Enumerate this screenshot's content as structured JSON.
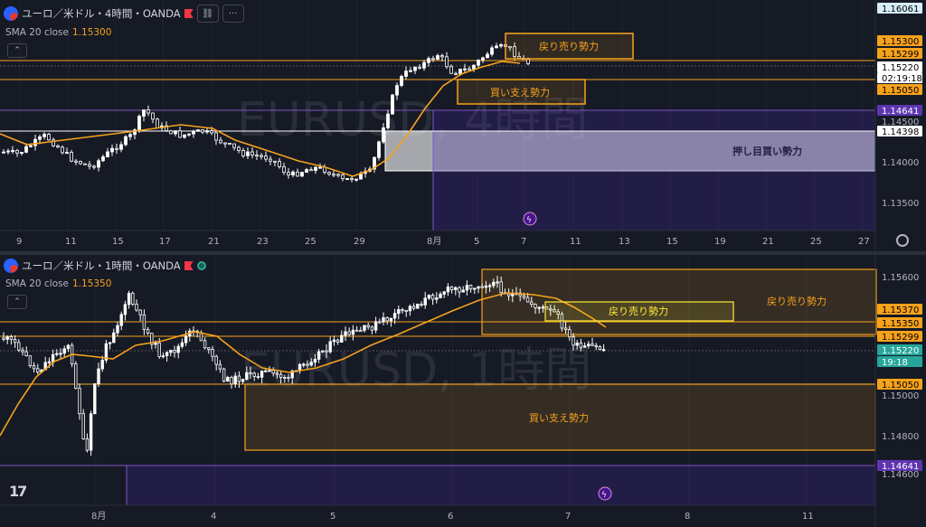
{
  "top": {
    "title": "ユーロ／米ドル・4時間・OANDA",
    "sma_label": "SMA 20 close",
    "sma_value": "1.15300",
    "watermark": "EURUSD, 4時間",
    "x_labels": [
      "9",
      "11",
      "15",
      "17",
      "21",
      "23",
      "25",
      "29",
      "8月",
      "5",
      "7",
      "11",
      "13",
      "15",
      "19",
      "21",
      "25",
      "27"
    ],
    "boxes": {
      "sell": "戻り売り勢力",
      "buy": "買い支え勢力",
      "pullback": "押し目買い勢力"
    },
    "price_tags": [
      {
        "text": "1.16061",
        "kind": "light-blue"
      },
      {
        "text": "1.15300",
        "kind": "orange"
      },
      {
        "text": "1.15299",
        "kind": "orange"
      },
      {
        "text": "1.15220",
        "kind": "white"
      },
      {
        "text": "02:19:18",
        "kind": "white-sub"
      },
      {
        "text": "1.15050",
        "kind": "orange"
      },
      {
        "text": "1.14641",
        "kind": "purple"
      },
      {
        "text": "1.14500",
        "kind": "plain"
      },
      {
        "text": "1.14398",
        "kind": "white-box"
      },
      {
        "text": "1.14000",
        "kind": "plain"
      },
      {
        "text": "1.13500",
        "kind": "plain"
      }
    ]
  },
  "bottom": {
    "title": "ユーロ／米ドル・1時間・OANDA",
    "sma_label": "SMA 20 close",
    "sma_value": "1.15350",
    "watermark": "EURUSD, 1時間",
    "x_labels": [
      "8月",
      "4",
      "5",
      "6",
      "7",
      "8",
      "11"
    ],
    "boxes": {
      "sell_big": "戻り売り勢力",
      "sell_small": "戻り売り勢力",
      "buy": "買い支え勢力"
    },
    "price_tags": [
      {
        "text": "1.15600",
        "kind": "plain"
      },
      {
        "text": "1.15370",
        "kind": "orange"
      },
      {
        "text": "1.15350",
        "kind": "orange"
      },
      {
        "text": "1.15299",
        "kind": "orange"
      },
      {
        "text": "1.15220",
        "kind": "green"
      },
      {
        "text": "19:18",
        "kind": "green-sub"
      },
      {
        "text": "1.15050",
        "kind": "orange"
      },
      {
        "text": "1.15000",
        "kind": "plain"
      },
      {
        "text": "1.14800",
        "kind": "plain"
      },
      {
        "text": "1.14641",
        "kind": "purple"
      },
      {
        "text": "1.14600",
        "kind": "plain"
      }
    ]
  },
  "icons": {
    "link": "link-icon",
    "more": "more-icon",
    "settings": "gear-icon",
    "alert": "lightning-icon",
    "logo": "tradingview-logo"
  },
  "logo_text": "17",
  "colors": {
    "up": "#ffffff",
    "down": "#ffffff",
    "sma": "#f7a21b",
    "orange": "#f7a21b",
    "purple": "#7e57c2",
    "green": "#26a69a",
    "bg": "#161a25"
  }
}
